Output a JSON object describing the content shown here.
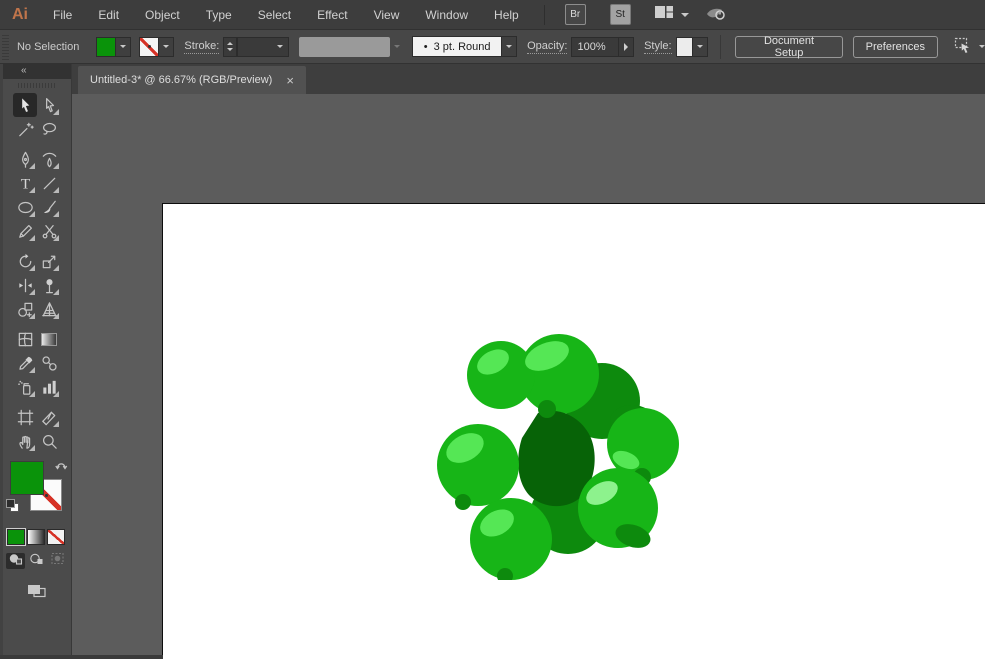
{
  "ui_colors": {
    "fill_green": "#0a930a",
    "slash_red": "#d63226",
    "menu_logo_orange": "#c0754b"
  },
  "menu_bar": {
    "logo_text": "Ai",
    "items": [
      "File",
      "Edit",
      "Object",
      "Type",
      "Select",
      "Effect",
      "View",
      "Window",
      "Help"
    ],
    "bridge_button": "Br",
    "stock_button": "St"
  },
  "control_bar": {
    "selection_status": "No Selection",
    "stroke_label": "Stroke:",
    "brush_bullet": "•",
    "brush_value": "3 pt. Round",
    "opacity_label": "Opacity:",
    "opacity_value": "100%",
    "style_label": "Style:",
    "document_setup_button": "Document Setup",
    "preferences_button": "Preferences"
  },
  "tab_bar": {
    "active_tab": {
      "title": "Untitled-3* @ 66.67% (RGB/Preview)",
      "close_glyph": "×"
    }
  },
  "tools_panel": {
    "collapse_glyph": "«",
    "tools": [
      {
        "name": "selection-tool",
        "icon": "selection-icon",
        "active": true,
        "flyout": false
      },
      {
        "name": "direct-selection-tool",
        "icon": "direct-selection-icon",
        "flyout": true
      },
      {
        "name": "magic-wand-tool",
        "icon": "magic-wand-icon",
        "flyout": false
      },
      {
        "name": "lasso-tool",
        "icon": "lasso-icon",
        "flyout": false
      },
      {
        "name": "pen-tool",
        "icon": "pen-icon",
        "flyout": true,
        "gap_before": true
      },
      {
        "name": "curvature-tool",
        "icon": "curvature-icon",
        "flyout": true,
        "gap_before": true
      },
      {
        "name": "type-tool",
        "icon": "type-icon",
        "flyout": true
      },
      {
        "name": "line-segment-tool",
        "icon": "line-segment-icon",
        "flyout": true
      },
      {
        "name": "ellipse-tool",
        "icon": "ellipse-icon",
        "flyout": true
      },
      {
        "name": "paintbrush-tool",
        "icon": "paintbrush-icon",
        "flyout": true
      },
      {
        "name": "pencil-tool",
        "icon": "pencil-icon",
        "flyout": true
      },
      {
        "name": "scissors-tool",
        "icon": "scissors-icon",
        "flyout": true
      },
      {
        "name": "rotate-tool",
        "icon": "rotate-icon",
        "flyout": true,
        "gap_before": true
      },
      {
        "name": "scale-tool",
        "icon": "scale-icon",
        "flyout": true,
        "gap_before": true
      },
      {
        "name": "width-tool",
        "icon": "width-icon",
        "flyout": true
      },
      {
        "name": "puppet-warp-tool",
        "icon": "puppet-warp-icon",
        "flyout": true
      },
      {
        "name": "shape-builder-tool",
        "icon": "shape-builder-icon",
        "flyout": true
      },
      {
        "name": "perspective-grid-tool",
        "icon": "perspective-grid-icon",
        "flyout": true
      },
      {
        "name": "mesh-tool",
        "icon": "mesh-icon",
        "flyout": false,
        "gap_before": true
      },
      {
        "name": "gradient-tool",
        "icon": "gradient-icon",
        "flyout": false,
        "gap_before": true
      },
      {
        "name": "eyedropper-tool",
        "icon": "eyedropper-icon",
        "flyout": true
      },
      {
        "name": "blend-tool",
        "icon": "blend-icon",
        "flyout": false
      },
      {
        "name": "symbol-sprayer-tool",
        "icon": "symbol-sprayer-icon",
        "flyout": true
      },
      {
        "name": "column-graph-tool",
        "icon": "column-graph-icon",
        "flyout": true
      },
      {
        "name": "artboard-tool",
        "icon": "artboard-icon",
        "flyout": false,
        "gap_before": true
      },
      {
        "name": "slice-tool",
        "icon": "slice-icon",
        "flyout": true,
        "gap_before": true
      },
      {
        "name": "hand-tool",
        "icon": "hand-icon",
        "flyout": true
      },
      {
        "name": "zoom-tool",
        "icon": "zoom-icon",
        "flyout": false
      }
    ]
  },
  "artwork": {
    "description": "cluster of glossy green berries with dark center hole",
    "colors": {
      "bright": "#17b517",
      "mid": "#0d8a0d",
      "dark": "#076307",
      "highlight": "#55e755",
      "highlight_light": "#8df28d"
    }
  }
}
